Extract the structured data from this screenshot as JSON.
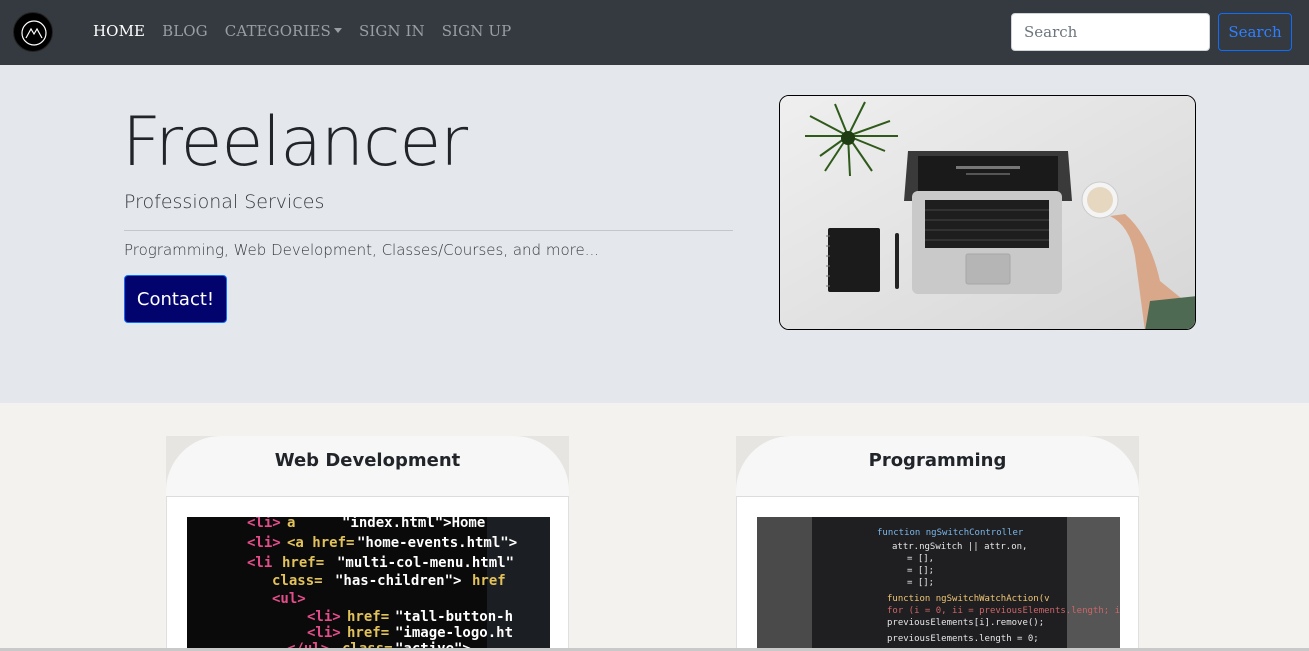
{
  "nav": {
    "links": [
      {
        "label": "HOME"
      },
      {
        "label": "BLOG"
      },
      {
        "label": "CATEGORIES"
      },
      {
        "label": "SIGN IN"
      },
      {
        "label": "SIGN UP"
      }
    ],
    "search_placeholder": "Search",
    "search_button": "Search"
  },
  "hero": {
    "title": "Freelancer",
    "subtitle": "Professional Services",
    "text": "Programming, Web Development, Classes/Courses, and more...",
    "contact_button": "Contact!"
  },
  "cards": [
    {
      "title": "Web Development"
    },
    {
      "title": "Programming"
    }
  ],
  "colors": {
    "navbar": "#343a40",
    "hero_bg": "#e4e7eb",
    "page_bg": "#f3f2ee",
    "contact_button": "#03036e",
    "search_button_border": "#0d6efd"
  }
}
